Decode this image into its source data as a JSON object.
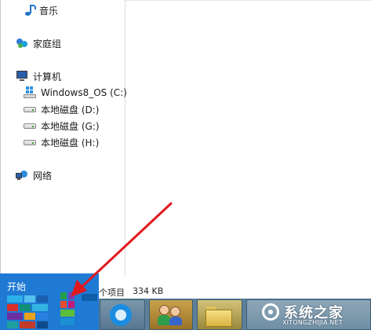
{
  "nav": {
    "music": "音乐",
    "homegroup": "家庭组",
    "computer": "计算机",
    "drives": [
      "Windows8_OS (C:)",
      "本地磁盘 (D:)",
      "本地磁盘 (G:)",
      "本地磁盘 (H:)"
    ],
    "network": "网络"
  },
  "status": {
    "items": "个项目",
    "size": "334 KB"
  },
  "start": {
    "label": "开始"
  },
  "watermark": {
    "title": "系统之家",
    "subtitle": "XITONGZHIJIA.NET"
  },
  "colors": {
    "start_tile": "#1f7ad4",
    "taskbar": "#5d7f99",
    "annotation_arrow": "#e0191f"
  },
  "icons": {
    "music": "music-note-icon",
    "homegroup": "homegroup-icon",
    "computer": "computer-icon",
    "system_drive": "windows-drive-icon",
    "drive": "hard-drive-icon",
    "network": "network-icon",
    "taskbar_1": "browser-icon",
    "taskbar_2": "users-icon",
    "taskbar_3": "file-explorer-icon"
  }
}
